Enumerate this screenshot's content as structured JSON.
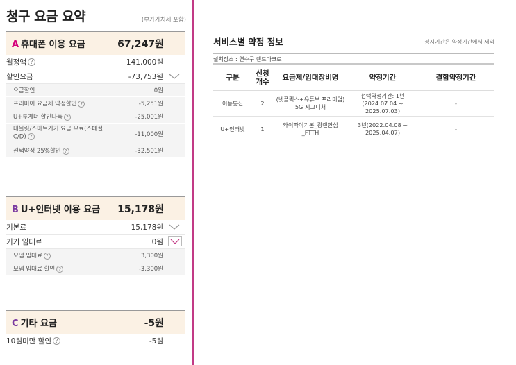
{
  "left": {
    "title": "청구 요금 요약",
    "vat_note": "(부가가치세 포함)",
    "sections": [
      {
        "letter": "A",
        "name": "휴대폰 이용 요금",
        "amount": "67,247원",
        "rows": [
          {
            "label": "월정액",
            "value": "141,000원"
          },
          {
            "label": "할인요금",
            "value": "-73,753원"
          }
        ],
        "subrows": [
          {
            "label": "요금할인",
            "value": "0원"
          },
          {
            "label": "프리미어 요금제 약정할인",
            "value": "-5,251원"
          },
          {
            "label": "U+투게더 할인나눔",
            "value": "-25,001원"
          },
          {
            "label": "태블릿/스마트기기 요금 무료(스페셜 C/D)",
            "value": "-11,000원"
          },
          {
            "label": "선택약정 25%할인",
            "value": "-32,501원"
          }
        ]
      },
      {
        "letter": "B",
        "name": "U+인터넷 이용 요금",
        "amount": "15,178원",
        "rows": [
          {
            "label": "기본료",
            "value": "15,178원"
          },
          {
            "label": "기기 임대료",
            "value": "0원"
          }
        ],
        "subrows": [
          {
            "label": "모뎀 임대료",
            "value": "3,300원"
          },
          {
            "label": "모뎀 임대료 할인",
            "value": "-3,300원"
          }
        ]
      },
      {
        "letter": "C",
        "name": "기타 요금",
        "amount": "-5원",
        "rows": [
          {
            "label": "10원미만 할인",
            "value": "-5원"
          }
        ]
      }
    ],
    "help_glyph": "?"
  },
  "right": {
    "title": "서비스별 약정 정보",
    "note": "정지기간은 약정기간에서 제외",
    "location": "설치장소 : 연수구 랜드마크로",
    "headers": [
      "구분",
      "신청\n개수",
      "요금제/임대장비명",
      "약정기간",
      "결합약정기간"
    ],
    "rows": [
      [
        "이동통신",
        "2",
        "(넷플릭스+유튜브 프리미엄) 5G 시그니처",
        "선택약정기간: 1년(2024.07.04 ~ 2025.07.03)",
        "-"
      ],
      [
        "U+인터넷",
        "1",
        "와이파이기본_광랜안심_FTTH",
        "3년(2022.04.08 ~ 2025.04.07)",
        "-"
      ]
    ]
  },
  "colors": {
    "accent_magenta": "#d4007a",
    "accent_purple": "#7a3aa0",
    "divider": "#c23a86",
    "section_header_bg": "#fbf1e4"
  },
  "icons": [
    "chevron-down-icon",
    "help-circle-icon"
  ]
}
